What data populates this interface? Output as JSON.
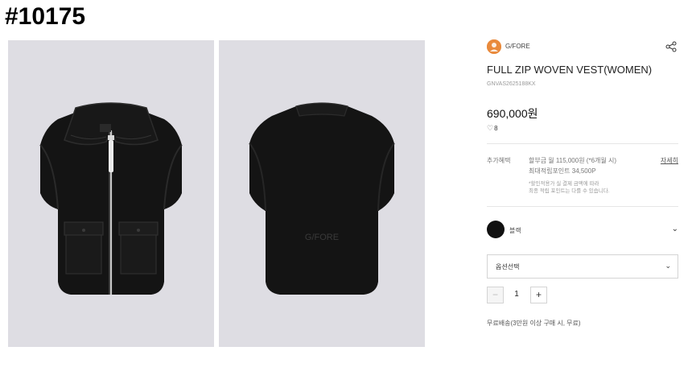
{
  "tag": "#10175",
  "brand": {
    "name": "G/FORE"
  },
  "product": {
    "title": "FULL ZIP WOVEN VEST(WOMEN)",
    "code": "GNVAS2625188KX",
    "price": "690,000원",
    "wish_count": "8"
  },
  "benefit": {
    "label": "추가혜택",
    "line1": "할부금 월 115,000원 (*6개월 시)",
    "line2": "최대적립포인트 34,500P",
    "note1": "*할인적용가 실 결제 금액에 따라",
    "note2": "최종 적립 포인트는 다를 수 있습니다.",
    "detail_link": "자세히"
  },
  "color": {
    "name": "블랙",
    "value": "#111111"
  },
  "option_select": {
    "placeholder": "옵션선택"
  },
  "quantity": {
    "minus": "−",
    "value": "1",
    "plus": "+"
  },
  "shipping": "무료배송(3만원 이상 구매 시, 무료)",
  "images": {
    "front_logo": "G/FORE",
    "back_logo": "G/FORE"
  },
  "icons": [
    "share-icon",
    "heart-icon",
    "chevron-down-icon"
  ]
}
